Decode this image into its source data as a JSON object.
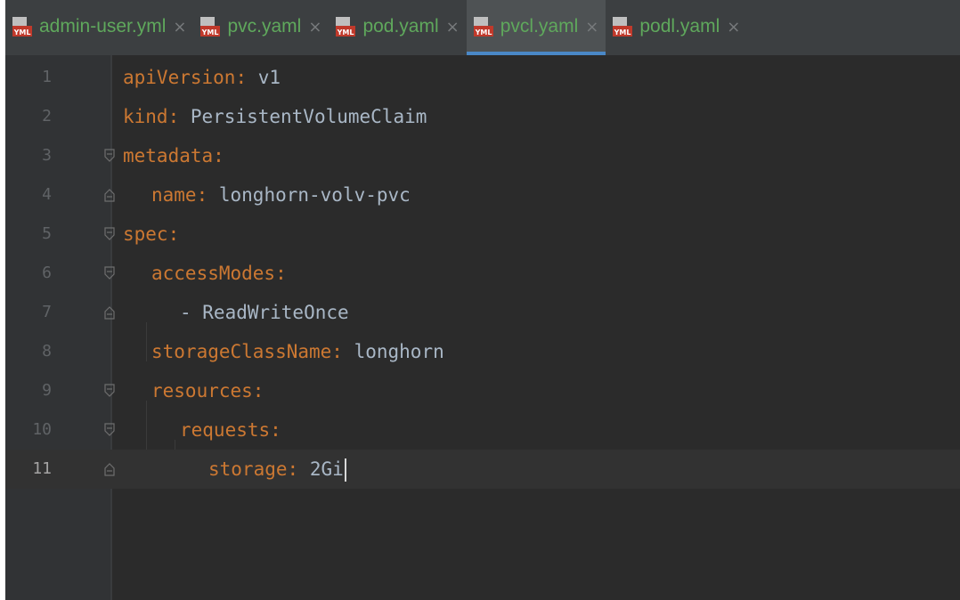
{
  "tabs": [
    {
      "label": "admin-user.yml",
      "icon": "yml-file-icon",
      "active": false
    },
    {
      "label": "pvc.yaml",
      "icon": "yml-file-icon",
      "active": false
    },
    {
      "label": "pod.yaml",
      "icon": "yml-file-icon",
      "active": false
    },
    {
      "label": "pvcl.yaml",
      "icon": "yml-file-icon",
      "active": true
    },
    {
      "label": "podl.yaml",
      "icon": "yml-file-icon",
      "active": false
    }
  ],
  "icons": {
    "close": "×",
    "file_badge": "YML"
  },
  "editor": {
    "current_line": 11,
    "lines": [
      {
        "num": "1",
        "key": "apiVersion",
        "sep": ":",
        "value": " v1"
      },
      {
        "num": "2",
        "key": "kind",
        "sep": ":",
        "value": " PersistentVolumeClaim"
      },
      {
        "num": "3",
        "key": "metadata",
        "sep": ":",
        "value": ""
      },
      {
        "num": "4",
        "key": "name",
        "sep": ":",
        "value": " longhorn-volv-pvc"
      },
      {
        "num": "5",
        "key": "spec",
        "sep": ":",
        "value": ""
      },
      {
        "num": "6",
        "key": "accessModes",
        "sep": ":",
        "value": ""
      },
      {
        "num": "7",
        "key": "",
        "sep": "",
        "value": "- ReadWriteOnce"
      },
      {
        "num": "8",
        "key": "storageClassName",
        "sep": ":",
        "value": " longhorn"
      },
      {
        "num": "9",
        "key": "resources",
        "sep": ":",
        "value": ""
      },
      {
        "num": "10",
        "key": "requests",
        "sep": ":",
        "value": ""
      },
      {
        "num": "11",
        "key": "storage",
        "sep": ":",
        "value": " 2Gi"
      }
    ]
  },
  "colors": {
    "background": "#2b2b2b",
    "gutter": "#313335",
    "tabbar": "#3c3f41",
    "active_tab_underline": "#4a88c7",
    "key": "#cc7832",
    "value": "#a9b7c6",
    "tab_text": "#5fa85c",
    "line_number": "#606366"
  }
}
